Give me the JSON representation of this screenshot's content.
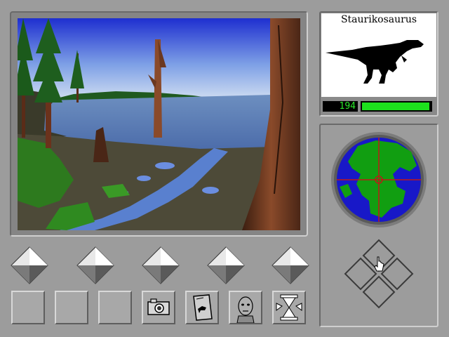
{
  "creature": {
    "name": "Staurikosaurus",
    "counter": "194",
    "health_fraction": 0.98
  },
  "icons": {
    "nav_up": "arrow-up-icon",
    "camera": "camera-icon",
    "field_guide": "field-guide-book-icon",
    "face": "face-icon",
    "hourglass": "hourglass-icon",
    "cursor": "hand-pointer-icon"
  },
  "colors": {
    "ui_gray": "#9c9c9c",
    "counter_text": "#2be82b",
    "health_green": "#1de01d",
    "ocean": "#1818c8",
    "land": "#119e11",
    "crosshair": "#c01818"
  }
}
